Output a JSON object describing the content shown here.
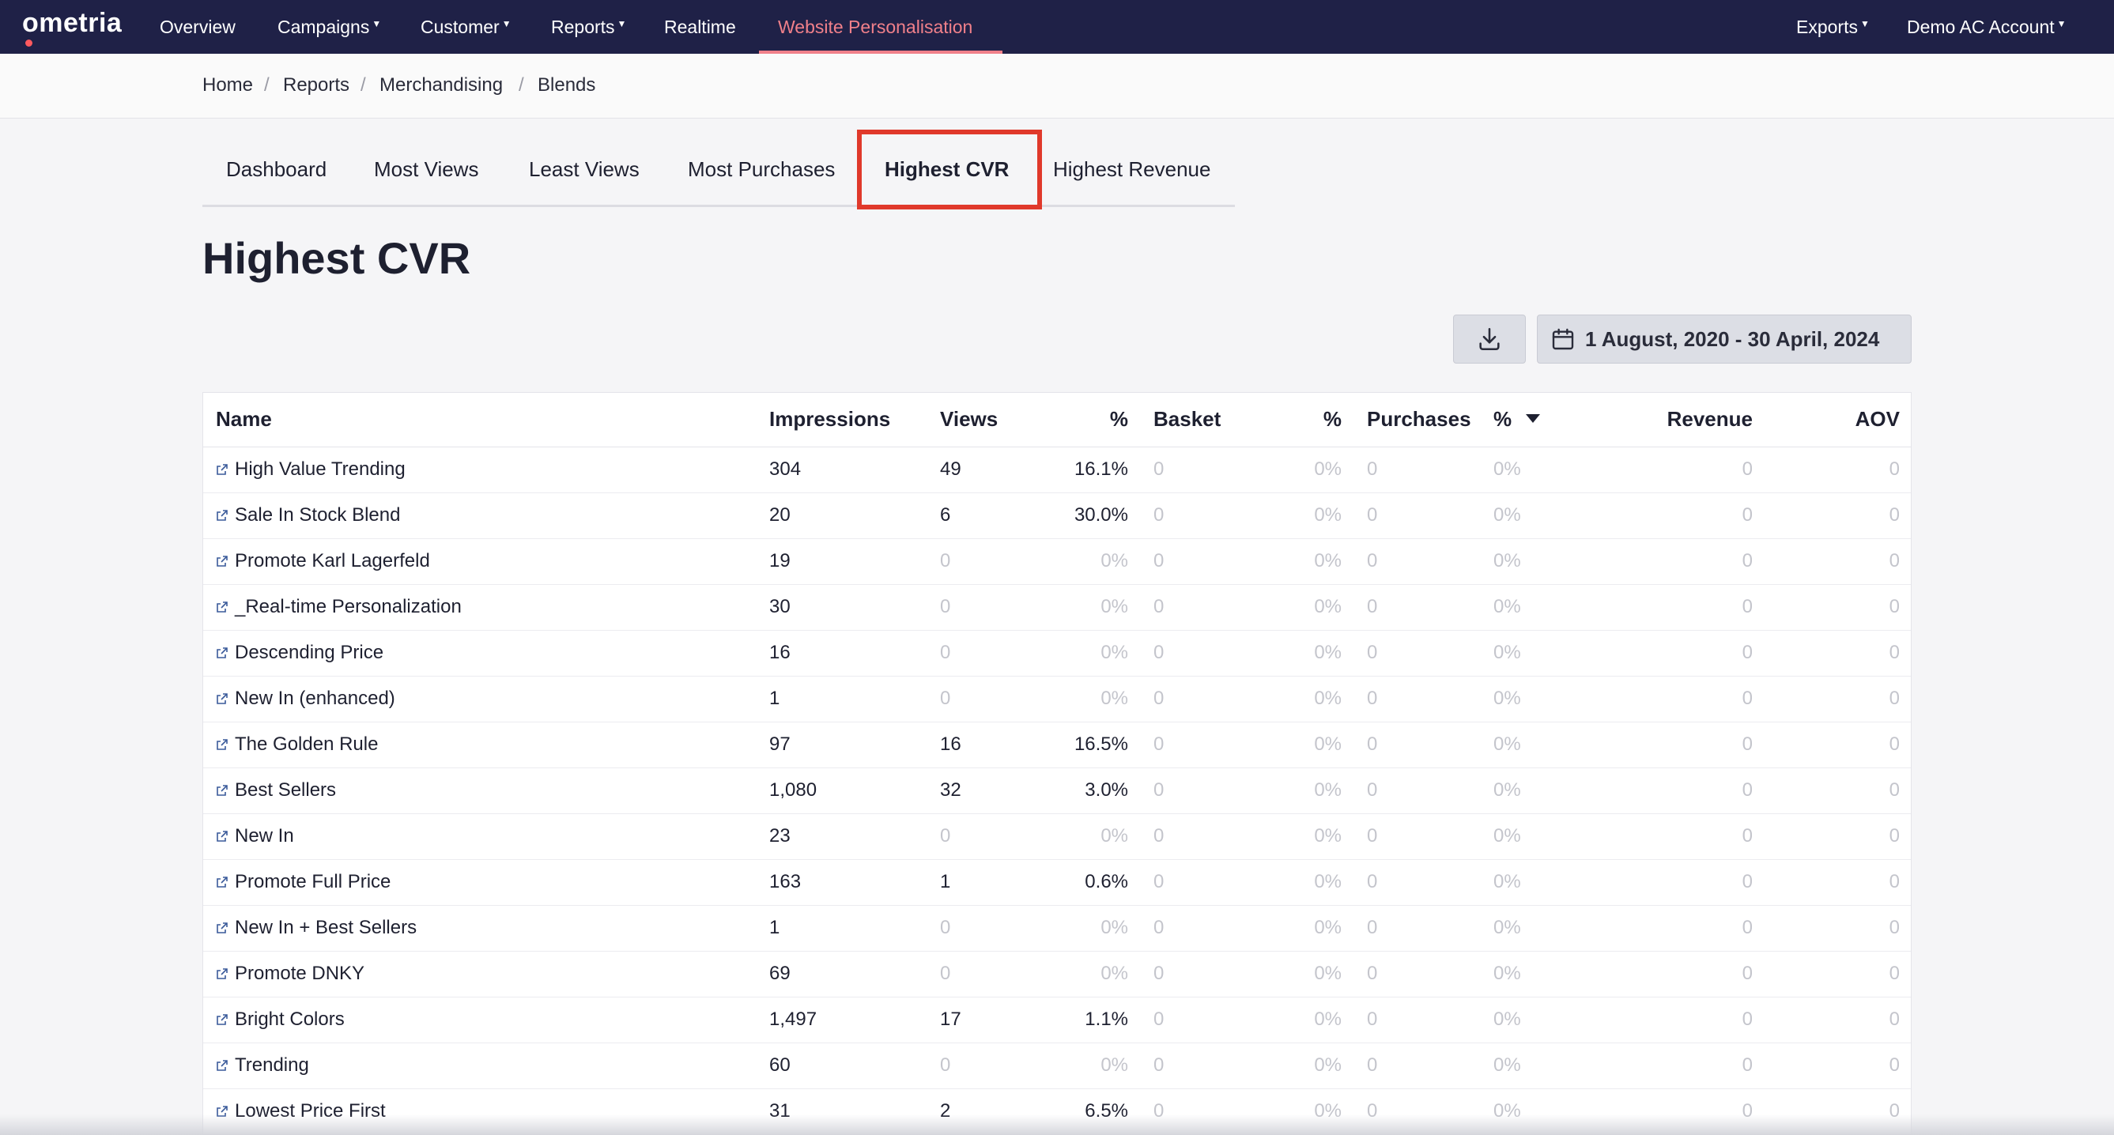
{
  "nav": {
    "brand": "ometria",
    "items": [
      "Overview",
      "Campaigns",
      "Customer",
      "Reports",
      "Realtime",
      "Website Personalisation"
    ],
    "right": [
      "Exports",
      "Demo AC Account"
    ],
    "active_color": "#f0808a",
    "bg_color": "#1f2147"
  },
  "breadcrumb": [
    "Home",
    "Reports",
    "Merchandising",
    "Blends"
  ],
  "tabs": [
    "Dashboard",
    "Most Views",
    "Least Views",
    "Most Purchases",
    "Highest CVR",
    "Highest Revenue"
  ],
  "active_tab": "Highest CVR",
  "highlight_color": "#e0392b",
  "page_title": "Highest CVR",
  "toolbar": {
    "download_icon": "download-icon",
    "calendar_icon": "calendar-icon",
    "date_range": "1 August, 2020 - 30 April, 2024"
  },
  "table": {
    "headers": [
      "Name",
      "Impressions",
      "Views",
      "%",
      "Basket",
      "%",
      "Purchases",
      "%",
      "Revenue",
      "AOV"
    ],
    "sorted_by": "Purchases %",
    "rows": [
      [
        "High Value Trending",
        "304",
        "49",
        "16.1%",
        "0",
        "0%",
        "0",
        "0%",
        "0",
        "0"
      ],
      [
        "Sale In Stock Blend",
        "20",
        "6",
        "30.0%",
        "0",
        "0%",
        "0",
        "0%",
        "0",
        "0"
      ],
      [
        "Promote Karl Lagerfeld",
        "19",
        "0",
        "0%",
        "0",
        "0%",
        "0",
        "0%",
        "0",
        "0"
      ],
      [
        "_Real-time Personalization",
        "30",
        "0",
        "0%",
        "0",
        "0%",
        "0",
        "0%",
        "0",
        "0"
      ],
      [
        "Descending Price",
        "16",
        "0",
        "0%",
        "0",
        "0%",
        "0",
        "0%",
        "0",
        "0"
      ],
      [
        "New In (enhanced)",
        "1",
        "0",
        "0%",
        "0",
        "0%",
        "0",
        "0%",
        "0",
        "0"
      ],
      [
        "The Golden Rule",
        "97",
        "16",
        "16.5%",
        "0",
        "0%",
        "0",
        "0%",
        "0",
        "0"
      ],
      [
        "Best Sellers",
        "1,080",
        "32",
        "3.0%",
        "0",
        "0%",
        "0",
        "0%",
        "0",
        "0"
      ],
      [
        "New In",
        "23",
        "0",
        "0%",
        "0",
        "0%",
        "0",
        "0%",
        "0",
        "0"
      ],
      [
        "Promote Full Price",
        "163",
        "1",
        "0.6%",
        "0",
        "0%",
        "0",
        "0%",
        "0",
        "0"
      ],
      [
        "New In + Best Sellers",
        "1",
        "0",
        "0%",
        "0",
        "0%",
        "0",
        "0%",
        "0",
        "0"
      ],
      [
        "Promote DNKY",
        "69",
        "0",
        "0%",
        "0",
        "0%",
        "0",
        "0%",
        "0",
        "0"
      ],
      [
        "Bright Colors",
        "1,497",
        "17",
        "1.1%",
        "0",
        "0%",
        "0",
        "0%",
        "0",
        "0"
      ],
      [
        "Trending",
        "60",
        "0",
        "0%",
        "0",
        "0%",
        "0",
        "0%",
        "0",
        "0"
      ],
      [
        "Lowest Price First",
        "31",
        "2",
        "6.5%",
        "0",
        "0%",
        "0",
        "0%",
        "0",
        "0"
      ]
    ]
  }
}
